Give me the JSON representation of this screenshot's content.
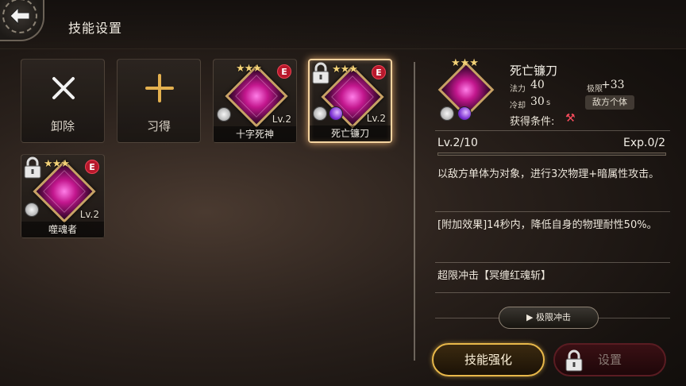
{
  "header": {
    "title": "技能设置"
  },
  "actions": [
    {
      "label": "卸除",
      "icon": "close-icon"
    },
    {
      "label": "习得",
      "icon": "plus-icon"
    }
  ],
  "skills": [
    {
      "name": "十字死神",
      "stars": "★★★",
      "rank": "E",
      "level": "Lv.2",
      "locked": false,
      "selected": false
    },
    {
      "name": "死亡镰刀",
      "stars": "★★★",
      "rank": "E",
      "level": "Lv.2",
      "locked": true,
      "selected": true
    },
    {
      "name": "噬魂者",
      "stars": "★★★",
      "rank": "E",
      "level": "Lv.2",
      "locked": true,
      "selected": false
    }
  ],
  "detail": {
    "name": "死亡镰刀",
    "stars": "★★★",
    "mana_label": "法力",
    "mana_value": "40",
    "cooldown_label": "冷却",
    "cooldown_value": "30",
    "cooldown_unit": "s",
    "limit_label": "极限",
    "limit_value": "+33",
    "target": "敌方个体",
    "condition_label": "获得条件:",
    "level": "Lv.2/10",
    "exp": "Exp.0/2",
    "exp_fraction": 0.0,
    "desc1": "以敌方单体为对象，进行3次物理+暗属性攻击。",
    "desc2": "[附加效果]14秒内，降低自身的物理耐性50%。",
    "desc3": "超限冲击【冥缠红魂斩】",
    "limit_button": "▶ 极限冲击"
  },
  "buttons": {
    "enhance": "技能强化",
    "setting": "设置"
  },
  "colors": {
    "accent_gold": "#e8b84a",
    "badge_red": "#b8182c",
    "gem_magenta": "#c3178e"
  }
}
